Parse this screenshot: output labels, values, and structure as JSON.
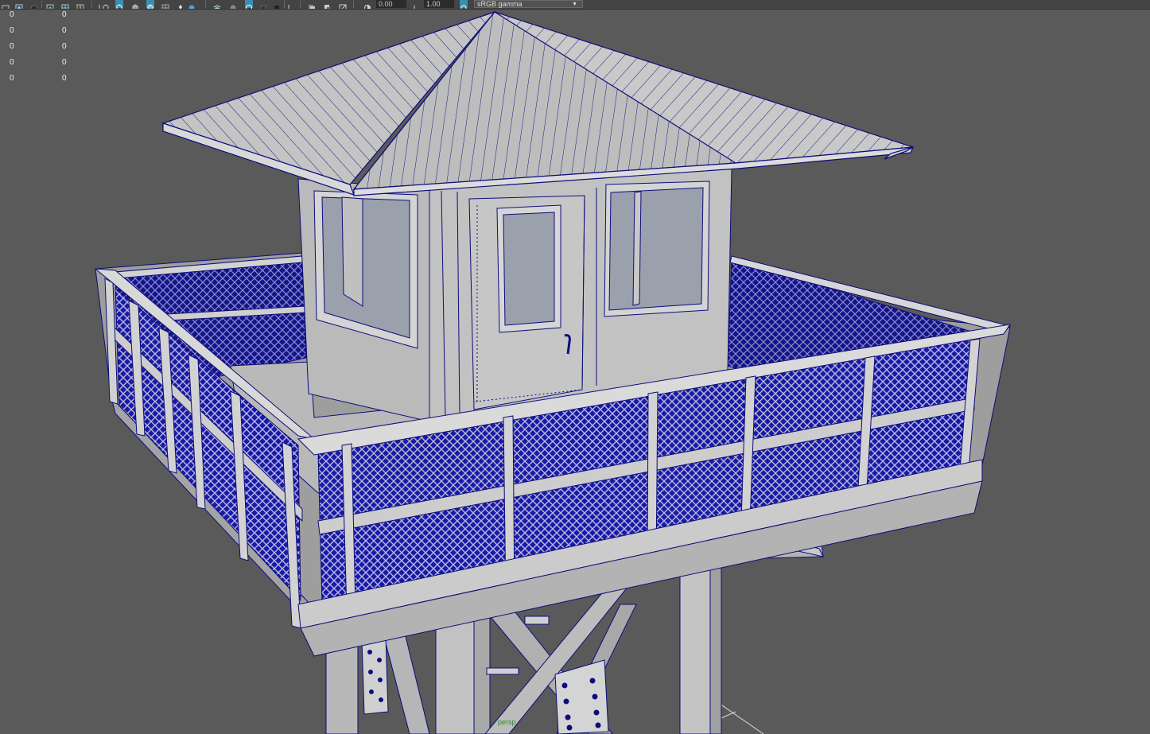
{
  "toolbar": {
    "exposure_value": "0.00",
    "gamma_value": "1.00",
    "color_space": "sRGB gamma",
    "icons": [
      "select-camera-icon",
      "camera-attributes-icon",
      "bookmark-icon",
      "image-plane-icon",
      "grid-icon",
      "film-gate-icon",
      "resolution-gate-icon",
      "gate-mask-icon",
      "field-chart-icon",
      "safe-action-icon",
      "safe-title-icon",
      "wireframe-icon",
      "smooth-shade-all-icon",
      "use-default-material-icon",
      "wireframe-on-shaded-icon",
      "textured-icon",
      "use-all-lights-icon",
      "shadows-icon",
      "screen-space-ao-icon",
      "motion-blur-icon",
      "multisample-aa-icon",
      "depth-of-field-icon",
      "isolate-select-icon",
      "xray-icon",
      "xray-active-components-icon",
      "xray-joints-icon",
      "exposure-icon",
      "gamma-icon",
      "color-management-icon"
    ]
  },
  "hud": {
    "rows": [
      {
        "label_value": "0",
        "value": "0"
      },
      {
        "label_value": "0",
        "value": "0"
      },
      {
        "label_value": "0",
        "value": "0"
      },
      {
        "label_value": "0",
        "value": "0"
      },
      {
        "label_value": "0",
        "value": "0"
      }
    ]
  },
  "viewport": {
    "camera_label": "persp",
    "background_color": "#5a5a5a",
    "wire_color": "#0d0d7a",
    "surface_color": "#c8c8c8"
  }
}
